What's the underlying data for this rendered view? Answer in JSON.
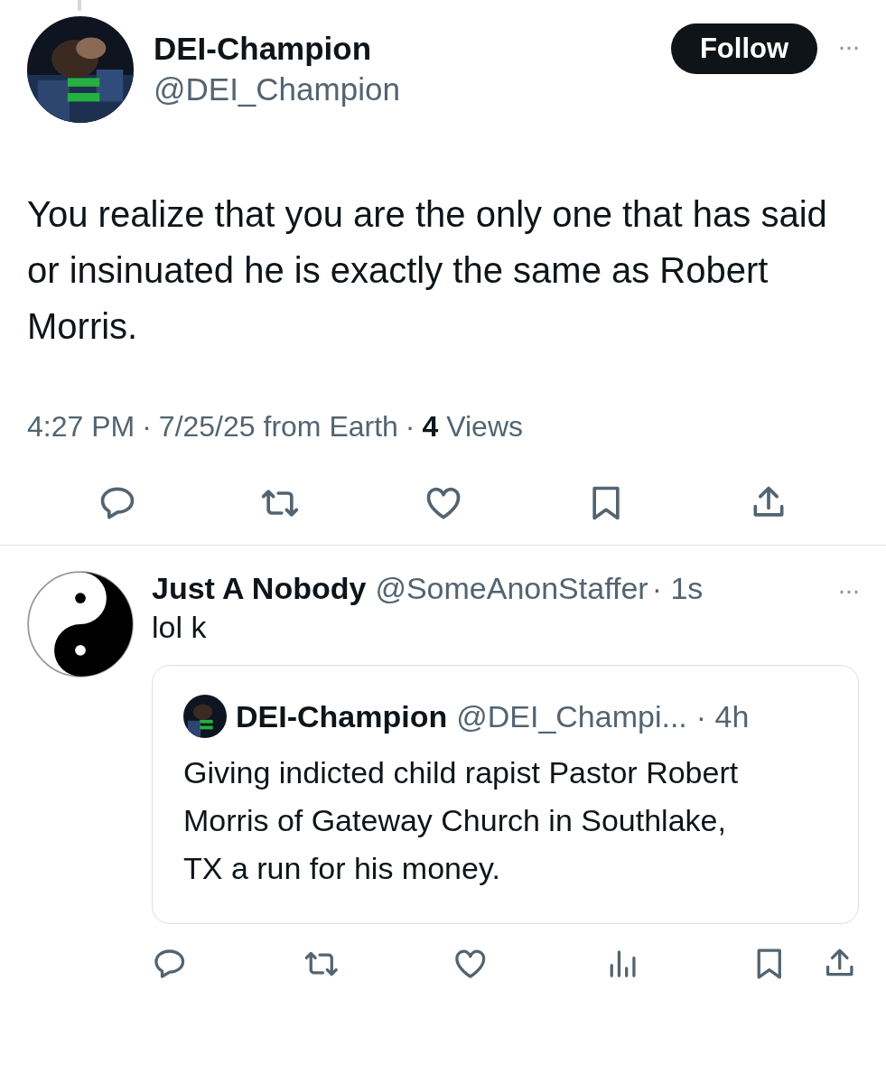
{
  "tweet": {
    "author": {
      "name": "DEI-Champion",
      "handle": "@DEI_Champion"
    },
    "follow_button": "Follow",
    "more": "···",
    "text": "You realize that you are the only one that has said or insinuated he is exactly the same as Robert Morris.",
    "meta": {
      "time": "4:27 PM",
      "separator_1": "·",
      "date": "7/25/25 from Earth",
      "separator_2": "·",
      "views_count": "4",
      "views_label": "Views"
    },
    "actions": [
      {
        "kind": "reply"
      },
      {
        "kind": "repost"
      },
      {
        "kind": "like"
      },
      {
        "kind": "bookmark"
      },
      {
        "kind": "share"
      }
    ]
  },
  "reply": {
    "author": {
      "name": "Just A Nobody",
      "handle": "@SomeAnonStaffer",
      "time": "· 1s"
    },
    "more": "···",
    "text": "lol k",
    "quoted": {
      "name": "DEI-Champion",
      "handle": "@DEI_Champi...",
      "time": "· 4h",
      "text": "Giving indicted child rapist Pastor Robert Morris of Gateway Church in Southlake, TX a run for his money."
    },
    "actions": [
      {
        "kind": "reply"
      },
      {
        "kind": "repost"
      },
      {
        "kind": "like"
      },
      {
        "kind": "views"
      },
      {
        "kind": "bookmark"
      },
      {
        "kind": "share"
      }
    ]
  }
}
